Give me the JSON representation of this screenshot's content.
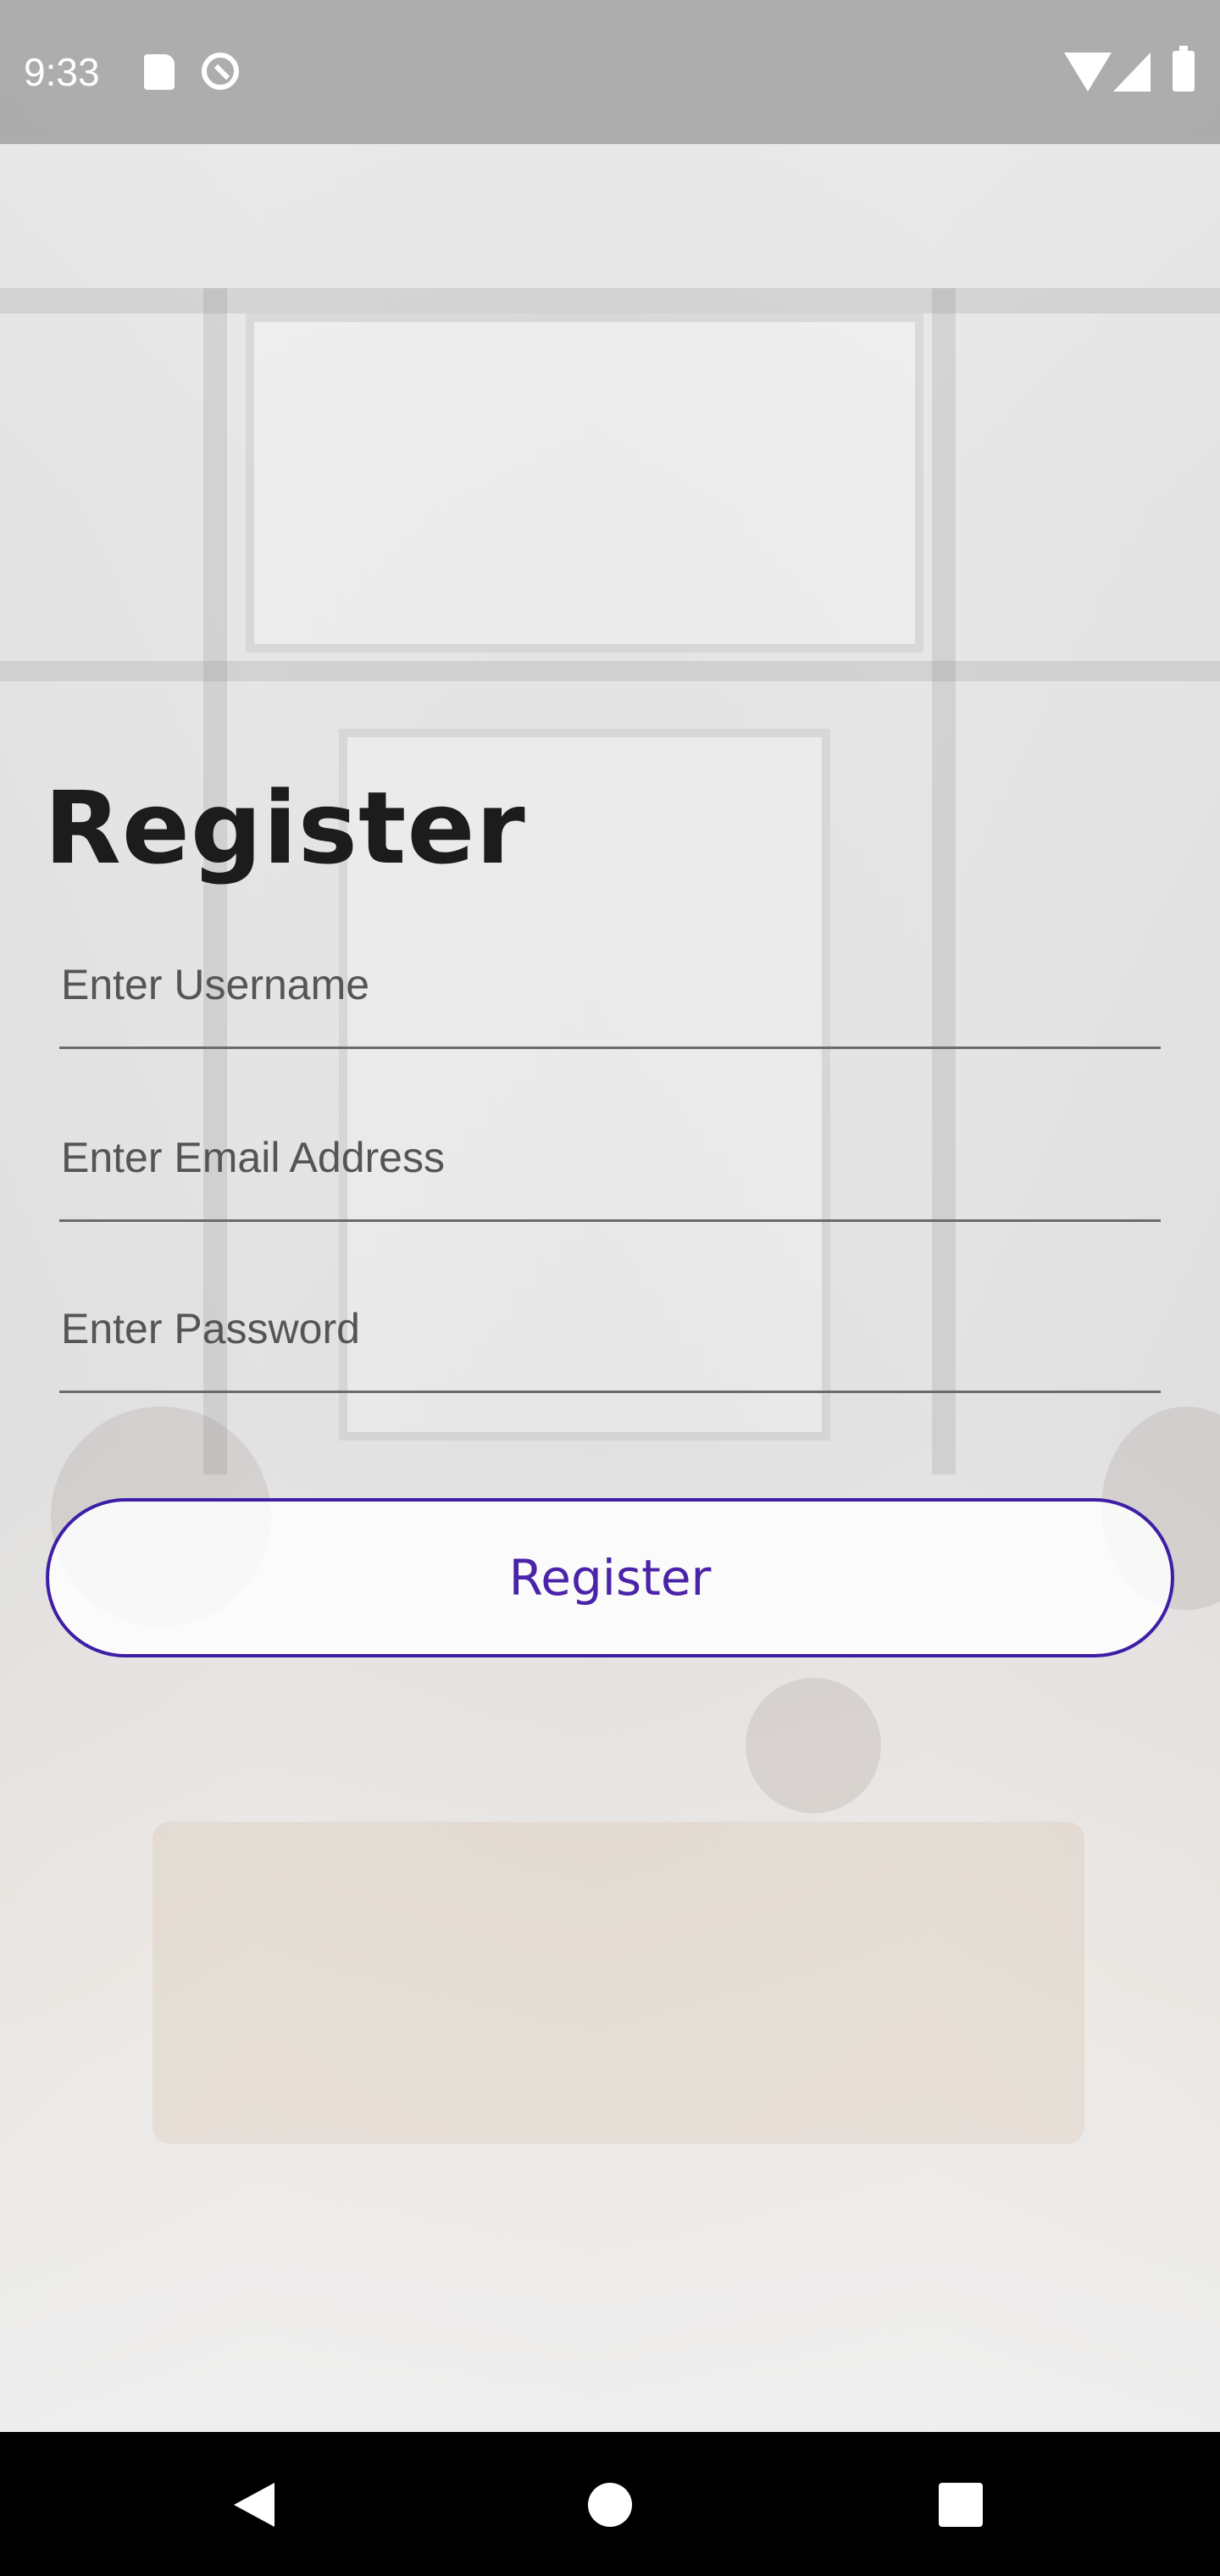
{
  "status_bar": {
    "time": "9:33",
    "icons": [
      "sd-card-icon",
      "sync-disabled-icon",
      "wifi-icon",
      "signal-icon",
      "battery-icon"
    ]
  },
  "register_form": {
    "title": "Register",
    "username": {
      "placeholder": "Enter Username",
      "value": ""
    },
    "email": {
      "placeholder": "Enter Email Address",
      "value": ""
    },
    "password": {
      "placeholder": "Enter Password",
      "value": ""
    },
    "submit_label": "Register"
  },
  "colors": {
    "accent": "#4a23a8",
    "button_border": "#3f1ea6",
    "title_text": "#1c1c1c"
  },
  "nav_bar": {
    "icons": [
      "back-icon",
      "home-icon",
      "recents-icon"
    ]
  }
}
